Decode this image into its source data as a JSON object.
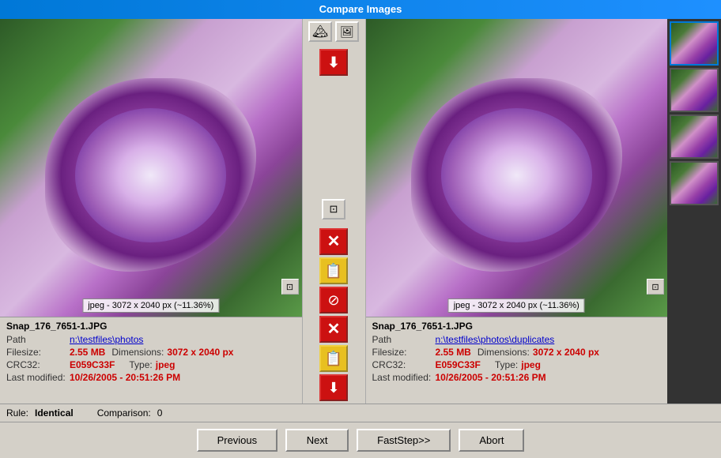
{
  "titleBar": {
    "title": "Compare Images"
  },
  "leftImage": {
    "filename": "Snap_176_7651-1.JPG",
    "pathLabel": "Path",
    "pathValue": "n:\\testfiles\\photos",
    "filesizeLabel": "Filesize:",
    "filesizeValue": "2.55 MB",
    "dimensionsLabel": "Dimensions:",
    "dimensionsValue": "3072 x 2040 px",
    "crc32Label": "CRC32:",
    "crc32Value": "E059C33F",
    "typeLabel": "Type:",
    "typeValue": "jpeg",
    "lastModifiedLabel": "Last modified:",
    "lastModifiedValue": "10/26/2005 - 20:51:26 PM",
    "imageLabel": "jpeg - 3072 x 2040 px (~11.36%)"
  },
  "rightImage": {
    "filename": "Snap_176_7651-1.JPG",
    "pathLabel": "Path",
    "pathValue": "n:\\testfiles\\photos\\duplicates",
    "filesizeLabel": "Filesize:",
    "filesizeValue": "2.55 MB",
    "dimensionsLabel": "Dimensions:",
    "dimensionsValue": "3072 x 2040 px",
    "crc32Label": "CRC32:",
    "crc32Value": "E059C33F",
    "typeLabel": "Type:",
    "typeValue": "jpeg",
    "lastModifiedLabel": "Last modified:",
    "lastModifiedValue": "10/26/2005 - 20:51:26 PM",
    "imageLabel": "jpeg - 3072 x 2040 px (~11.36%)"
  },
  "rule": {
    "label": "Rule:",
    "value": "Identical",
    "comparisonLabel": "Comparison:",
    "comparisonValue": "0"
  },
  "buttons": {
    "previous": "Previous",
    "next": "Next",
    "fastStep": "FastStep>>",
    "abort": "Abort"
  },
  "centerButtons": {
    "deleteLeft": "×",
    "moveLeft": "📋",
    "noLeft": "⊘",
    "deleteRight": "×",
    "moveRight": "📋",
    "downloadRight": "⬇"
  },
  "thumbnails": [
    {
      "id": 1,
      "active": true
    },
    {
      "id": 2,
      "active": false
    },
    {
      "id": 3,
      "active": false
    },
    {
      "id": 4,
      "active": false
    }
  ]
}
